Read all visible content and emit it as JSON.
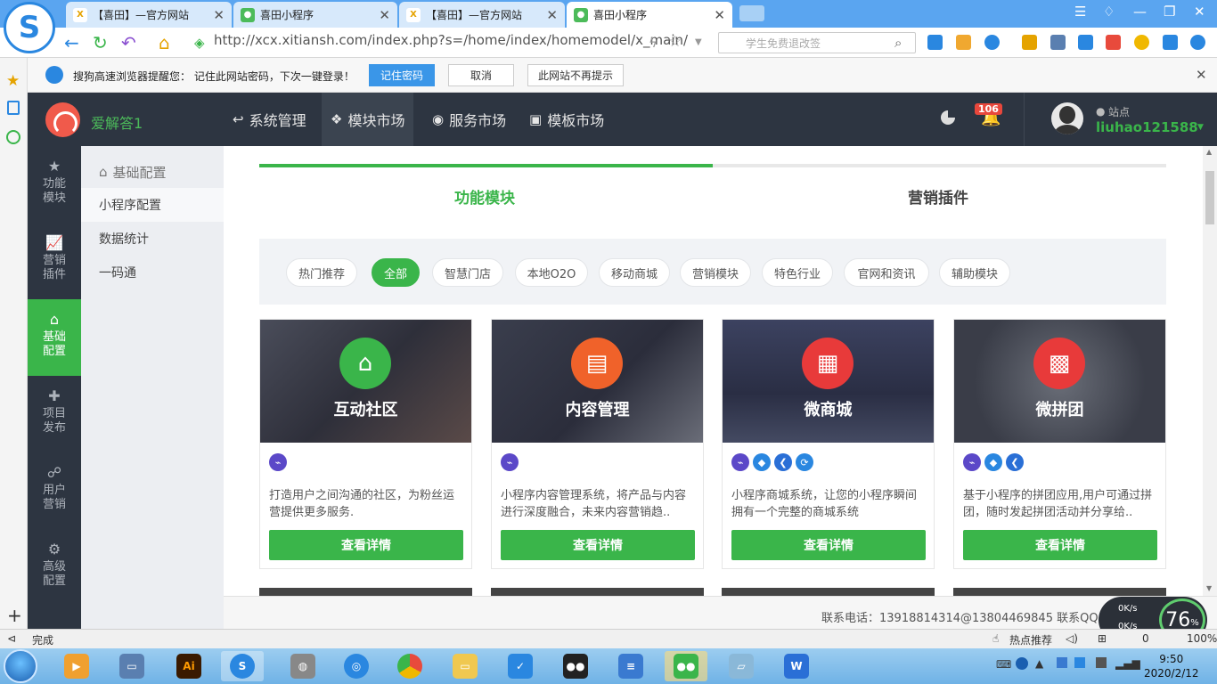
{
  "browser": {
    "tabs": [
      {
        "title": "【喜田】—官方网站",
        "active": false
      },
      {
        "title": "喜田小程序",
        "active": false
      },
      {
        "title": "【喜田】—官方网站",
        "active": false
      },
      {
        "title": "喜田小程序",
        "active": true
      }
    ],
    "url": "http://xcx.xitiansh.com/index.php?s=/home/index/homemodel/x_main/",
    "search_placeholder": "学生免费退改签",
    "password_bar": {
      "message": "搜狗高速浏览器提醒您： 记住此网站密码，下次一键登录！",
      "remember": "记住密码",
      "cancel": "取消",
      "never": "此网站不再提示"
    },
    "status_left": "完成",
    "status_hot": "热点推荐",
    "status_zoom": "100%",
    "status_count": "0"
  },
  "app": {
    "name": "爱解答1",
    "topnav": [
      {
        "label": "系统管理",
        "icon": "reply-icon"
      },
      {
        "label": "模块市场",
        "icon": "cubes-icon"
      },
      {
        "label": "服务市场",
        "icon": "globe-icon"
      },
      {
        "label": "模板市场",
        "icon": "briefcase-icon"
      }
    ],
    "notifications": "106",
    "user": {
      "role": "站点",
      "name": "liuhao121588"
    },
    "leftnav": [
      {
        "label": "功能模块",
        "icon": "star-icon"
      },
      {
        "label": "营销插件",
        "icon": "chart-icon"
      },
      {
        "label": "基础配置",
        "icon": "home-icon"
      },
      {
        "label": "项目发布",
        "icon": "puzzle-icon"
      },
      {
        "label": "用户营销",
        "icon": "sitemap-icon"
      },
      {
        "label": "高级配置",
        "icon": "gear-icon"
      }
    ],
    "submenu": {
      "header": "基础配置",
      "items": [
        "小程序配置",
        "数据统计",
        "一码通"
      ]
    },
    "content_tabs": [
      "功能模块",
      "营销插件"
    ],
    "filters": [
      "热门推荐",
      "全部",
      "智慧门店",
      "本地O2O",
      "移动商城",
      "营销模块",
      "特色行业",
      "官网和资讯",
      "辅助模块"
    ],
    "cards": [
      {
        "title": "互动社区",
        "desc": "打造用户之间沟通的社区，为粉丝运营提供更多服务.",
        "button": "查看详情",
        "accent": "#3ab54a"
      },
      {
        "title": "内容管理",
        "desc": "小程序内容管理系统，将产品与内容进行深度融合，未来内容营销趋..",
        "button": "查看详情",
        "accent": "#f0622a"
      },
      {
        "title": "微商城",
        "desc": "小程序商城系统，让您的小程序瞬间拥有一个完整的商城系统",
        "button": "查看详情",
        "accent": "#e83a3a"
      },
      {
        "title": "微拼团",
        "desc": "基于小程序的拼团应用,用户可通过拼团，随时发起拼团活动并分享给..",
        "button": "查看详情",
        "accent": "#e83a3a"
      }
    ],
    "footer": "联系电话：13918814314@13804469845    联系QQ："
  },
  "speed": {
    "up": "0K/s",
    "down": "0K/s",
    "percent": "76",
    "percent_sign": "%"
  },
  "clock": {
    "time": "9:50",
    "date": "2020/2/12"
  }
}
